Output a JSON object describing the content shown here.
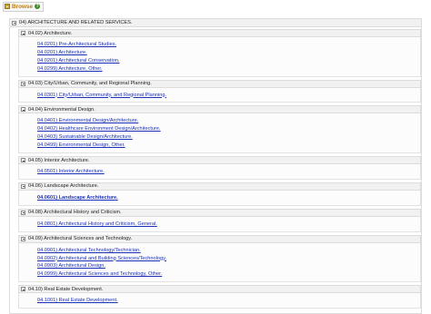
{
  "browse": {
    "label": "Browse",
    "help": "?"
  },
  "root": {
    "title": "04) ARCHITECTURE AND RELATED SERVICES.",
    "groups": [
      {
        "title": "04.02) Architecture.",
        "items": [
          "04.0201) Pre-Architectural Studies.",
          "04.0201) Architecture.",
          "04.0201) Architectural Conservation.",
          "04.0299) Architecture, Other."
        ]
      },
      {
        "title": "04.03) City/Urban, Community, and Regional Planning.",
        "items": [
          "04.0301) City/Urban, Community, and Regional Planning."
        ]
      },
      {
        "title": "04.04) Environmental Design.",
        "items": [
          "04.0401) Environmental Design/Architecture.",
          "04.0402) Healthcare Environment Design/Architecture.",
          "04.0403) Sustainable Design/Architecture.",
          "04.0499) Environmental Design, Other."
        ]
      },
      {
        "title": "04.05) Interior Architecture.",
        "items": [
          "04.0501) Interior Architecture."
        ]
      },
      {
        "title": "04.06) Landscape Architecture.",
        "items": [
          "04.0601) Landscape Architecture."
        ]
      },
      {
        "title": "04.08) Architectural History and Criticism.",
        "items": [
          "04.0801) Architectural History and Criticism, General."
        ]
      },
      {
        "title": "04.09) Architectural Sciences and Technology.",
        "items": [
          "04.0901) Architectural Technology/Technician.",
          "04.0902) Architectural and Building Sciences/Technology.",
          "04.0903) Architectural Design.",
          "04.0999) Architectural Sciences and Technology, Other."
        ]
      },
      {
        "title": "04.10) Real Estate Development.",
        "items": [
          "04.1001) Real Estate Development."
        ]
      }
    ]
  }
}
